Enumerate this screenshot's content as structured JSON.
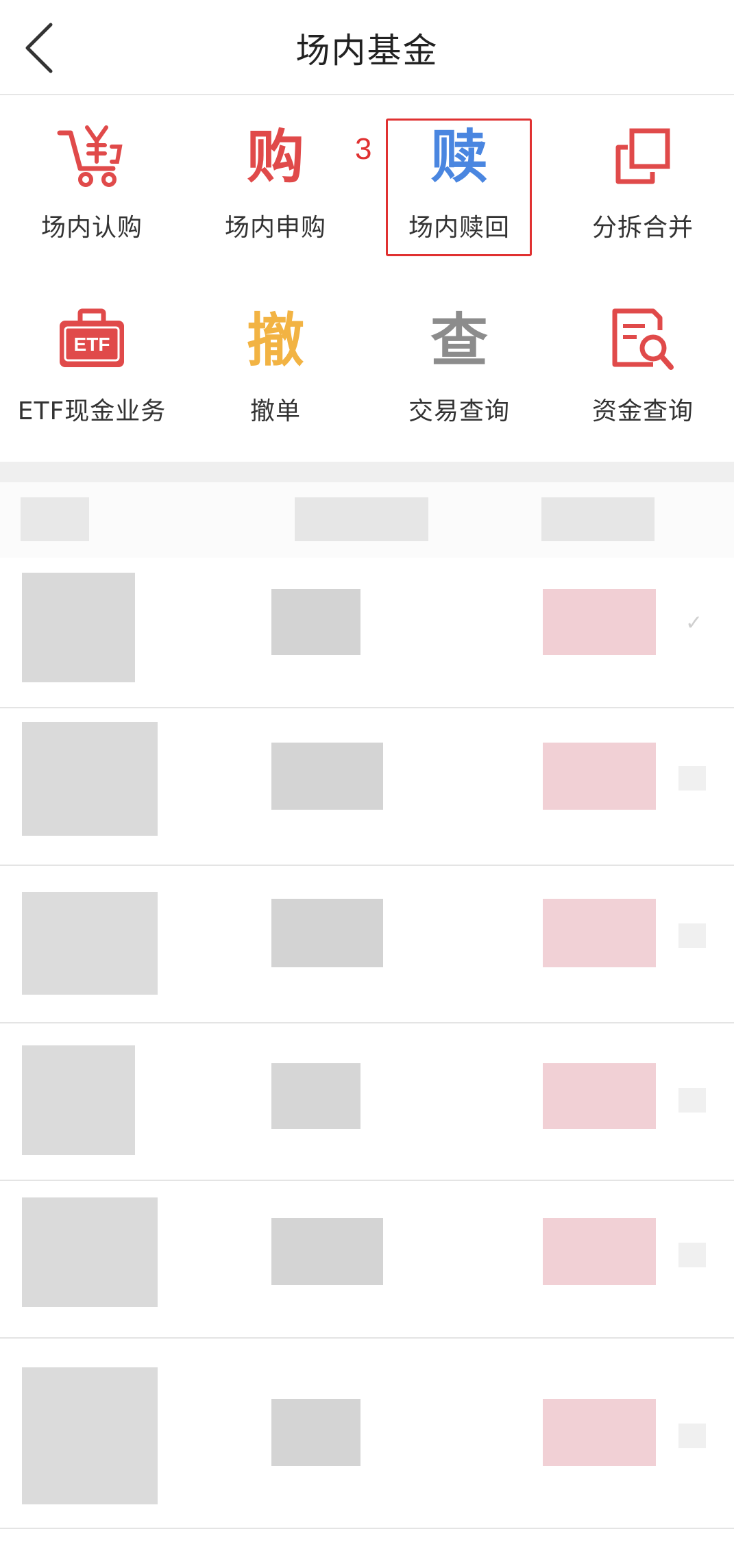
{
  "header": {
    "title": "场内基金",
    "back_icon": "chevron-left-icon"
  },
  "menu": [
    {
      "id": "subscribe",
      "label": "场内认购",
      "icon": "cart-yen-icon",
      "color": "#e04a4a"
    },
    {
      "id": "purchase",
      "label": "场内申购",
      "glyph": "购",
      "icon": "purchase-glyph-icon",
      "color": "#e04a4a"
    },
    {
      "id": "redeem",
      "label": "场内赎回",
      "glyph": "赎",
      "icon": "redeem-glyph-icon",
      "color": "#4a86e0"
    },
    {
      "id": "split-merge",
      "label": "分拆合并",
      "icon": "split-merge-icon",
      "color": "#e04a4a"
    },
    {
      "id": "etf-cash",
      "label": "ETF现金业务",
      "icon": "etf-case-icon",
      "color": "#e04a4a"
    },
    {
      "id": "cancel-order",
      "label": "撤单",
      "glyph": "撤",
      "icon": "cancel-glyph-icon",
      "color": "#f2b343"
    },
    {
      "id": "trade-query",
      "label": "交易查询",
      "glyph": "查",
      "icon": "query-glyph-icon",
      "color": "#8c8c8c"
    },
    {
      "id": "fund-query",
      "label": "资金查询",
      "icon": "document-search-icon",
      "color": "#e04a4a"
    }
  ],
  "annotation": {
    "marker": "3"
  },
  "list": {
    "rows": 6,
    "blurred": true
  }
}
